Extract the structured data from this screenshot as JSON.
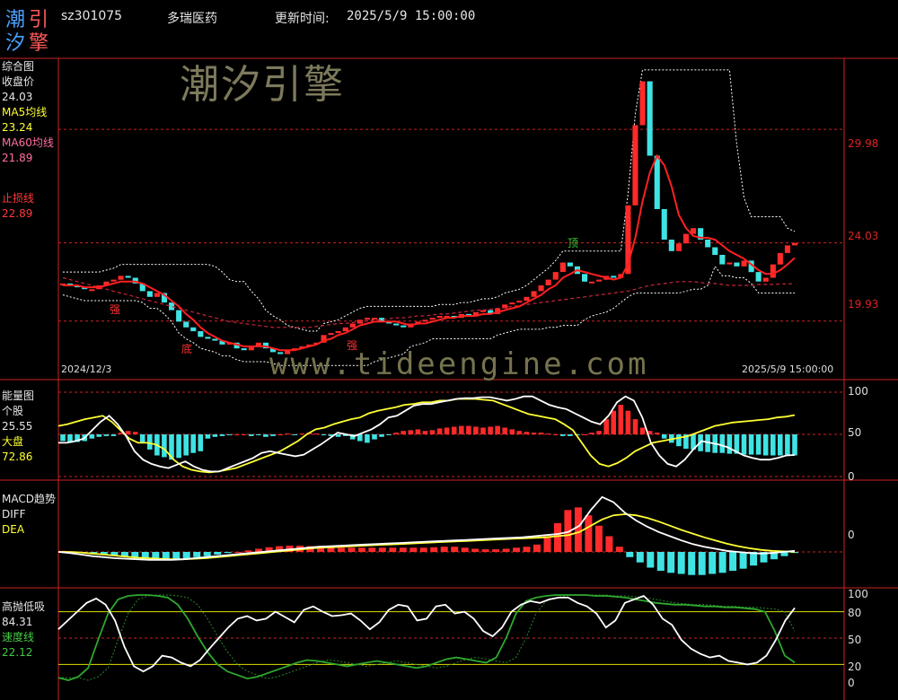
{
  "header": {
    "code": "sz301075",
    "name": "多瑞医药",
    "update_label": "更新时间:",
    "update_time": "2025/5/9 15:00:00",
    "logo_chars": [
      "潮",
      "引",
      "汐",
      "擎"
    ]
  },
  "watermark": {
    "brand": "潮汐引擎",
    "url": "www.tideengine.com"
  },
  "colors": {
    "up": "#ff2a2a",
    "down": "#3fe3e3",
    "ma5": "#ffff33",
    "ma60": "#ff6fa0",
    "ma": "#ff2020",
    "grid": "#cc2222",
    "axisText": "#dd2222"
  },
  "panels": {
    "main": {
      "title": "综合图",
      "close_label": "收盘价",
      "close_value": "24.03",
      "ma5_label": "MA5均线",
      "ma5_value": "23.24",
      "ma60_label": "MA60均线",
      "ma60_value": "21.89",
      "stop_label": "止损线",
      "stop_value": "22.89",
      "ticks": [
        "29.98",
        "24.03",
        "19.93"
      ],
      "date_start": "2024/12/3",
      "date_end": "2025/5/9 15:00:00",
      "annotations": [
        "强",
        "底",
        "强",
        "顶"
      ]
    },
    "energy": {
      "title": "能量图",
      "stock_label": "个股",
      "stock_value": "25.55",
      "market_label": "大盘",
      "market_value": "72.86",
      "ticks": [
        "100",
        "50",
        "0"
      ]
    },
    "macd": {
      "title": "MACD趋势",
      "diff_label": "DIFF",
      "dea_label": "DEA",
      "ticks": [
        "0"
      ]
    },
    "kdj": {
      "title": "高抛低吸",
      "value1": "84.31",
      "speed_label": "速度线",
      "speed_value": "22.12",
      "ticks": [
        "100",
        "80",
        "50",
        "20",
        "0"
      ]
    }
  },
  "chart_data": [
    {
      "type": "candlestick",
      "title": "综合图",
      "x_range": [
        "2024/12/3",
        "2025/5/9"
      ],
      "ylim": [
        17.0,
        33.0
      ],
      "y_ticks": [
        19.93,
        24.03,
        29.98
      ],
      "closes": [
        21.9,
        21.8,
        21.7,
        21.6,
        21.6,
        21.8,
        22.0,
        22.1,
        22.3,
        22.2,
        21.9,
        21.5,
        21.2,
        21.4,
        20.9,
        20.5,
        19.9,
        19.6,
        19.4,
        19.1,
        19.0,
        18.9,
        18.7,
        18.8,
        18.5,
        18.4,
        18.6,
        18.8,
        18.5,
        18.3,
        18.2,
        18.4,
        18.5,
        18.6,
        18.7,
        18.8,
        19.2,
        19.3,
        19.4,
        19.6,
        19.8,
        20.0,
        20.1,
        20.1,
        19.9,
        19.8,
        19.7,
        19.6,
        19.8,
        19.9,
        20.0,
        20.1,
        20.2,
        20.2,
        20.1,
        20.3,
        20.2,
        20.4,
        20.5,
        20.3,
        20.6,
        20.8,
        20.9,
        21.0,
        21.2,
        21.5,
        21.8,
        22.1,
        22.5,
        23.0,
        22.8,
        22.4,
        22.0,
        22.0,
        22.1,
        22.3,
        22.2,
        22.4,
        26.0,
        30.2,
        32.5,
        28.6,
        25.8,
        24.2,
        23.6,
        24.0,
        24.5,
        24.8,
        24.2,
        23.8,
        23.4,
        22.9,
        23.0,
        22.8,
        23.1,
        22.5,
        22.0,
        22.2,
        22.9,
        23.5,
        23.9,
        24.03
      ],
      "series": [
        {
          "name": "MA5均线",
          "values": [
            21.8,
            21.8,
            21.8,
            21.7,
            21.7,
            21.7,
            21.8,
            21.9,
            22.0,
            22.0,
            22.0,
            21.9,
            21.7,
            21.5,
            21.3,
            21.0,
            20.7,
            20.3,
            20.0,
            19.6,
            19.3,
            19.1,
            18.9,
            18.8,
            18.7,
            18.6,
            18.6,
            18.6,
            18.6,
            18.5,
            18.4,
            18.4,
            18.4,
            18.5,
            18.6,
            18.7,
            18.9,
            19.0,
            19.2,
            19.3,
            19.5,
            19.7,
            19.8,
            19.9,
            19.9,
            19.9,
            19.9,
            19.8,
            19.7,
            19.8,
            19.8,
            19.9,
            20.0,
            20.1,
            20.1,
            20.2,
            20.2,
            20.2,
            20.3,
            20.3,
            20.4,
            20.5,
            20.6,
            20.7,
            20.9,
            21.1,
            21.3,
            21.6,
            21.8,
            22.2,
            22.4,
            22.6,
            22.5,
            22.4,
            22.3,
            22.2,
            22.1,
            22.2,
            22.9,
            24.3,
            26.2,
            27.7,
            28.6,
            28.1,
            27.0,
            25.5,
            24.8,
            24.4,
            24.3,
            24.3,
            24.2,
            23.9,
            23.6,
            23.4,
            23.2,
            22.9,
            22.6,
            22.4,
            22.4,
            22.6,
            22.9,
            23.24
          ]
        },
        {
          "name": "MA60均线",
          "values": [
            22.2,
            22.1,
            22.0,
            21.9,
            21.8,
            21.7,
            21.6,
            21.5,
            21.4,
            21.3,
            21.2,
            21.1,
            21.0,
            20.9,
            20.8,
            20.7,
            20.6,
            20.5,
            20.4,
            20.3,
            20.2,
            20.1,
            20.0,
            19.9,
            19.85,
            19.8,
            19.75,
            19.7,
            19.65,
            19.6,
            19.6,
            19.6,
            19.6,
            19.6,
            19.6,
            19.65,
            19.7,
            19.75,
            19.8,
            19.8,
            19.85,
            19.9,
            19.95,
            20.0,
            20.0,
            20.05,
            20.1,
            20.1,
            20.15,
            20.2,
            20.2,
            20.25,
            20.3,
            20.3,
            20.35,
            20.4,
            20.45,
            20.5,
            20.5,
            20.55,
            20.6,
            20.65,
            20.7,
            20.75,
            20.8,
            20.85,
            20.9,
            20.95,
            21.0,
            21.05,
            21.1,
            21.15,
            21.2,
            21.25,
            21.3,
            21.35,
            21.4,
            21.45,
            21.5,
            21.6,
            21.7,
            21.8,
            21.85,
            21.9,
            21.95,
            22.0,
            22.0,
            22.0,
            21.95,
            21.9,
            21.9,
            21.85,
            21.8,
            21.8,
            21.8,
            21.8,
            21.85,
            21.85,
            21.85,
            21.87,
            21.88,
            21.89
          ]
        }
      ]
    },
    {
      "type": "bar",
      "title": "能量图",
      "ylim": [
        0,
        100
      ],
      "y_ticks": [
        0,
        50,
        100
      ],
      "bars": [
        -8,
        -10,
        -9,
        -8,
        -5,
        -3,
        -2,
        -2,
        2,
        4,
        3,
        -10,
        -18,
        -25,
        -27,
        -30,
        -28,
        -25,
        -22,
        -20,
        -5,
        -3,
        -2,
        -1,
        0,
        0,
        -2,
        -1,
        -3,
        -2,
        0,
        1,
        -1,
        1,
        2,
        1,
        -1,
        -2,
        -3,
        -2,
        -6,
        -8,
        -10,
        -6,
        -3,
        -1,
        2,
        4,
        5,
        6,
        4,
        5,
        7,
        8,
        9,
        10,
        10,
        9,
        8,
        9,
        10,
        8,
        6,
        4,
        3,
        2,
        2,
        1,
        0,
        -2,
        -2,
        -1,
        0,
        2,
        4,
        18,
        28,
        35,
        28,
        18,
        8,
        4,
        2,
        -5,
        -10,
        -14,
        -17,
        -18,
        -20,
        -21,
        -22,
        -22,
        -23,
        -23,
        -24,
        -24,
        -24,
        -25,
        -25,
        -25,
        -25,
        -25
      ],
      "series": [
        {
          "name": "个股",
          "values": [
            40,
            40,
            42,
            45,
            55,
            65,
            72,
            62,
            48,
            30,
            20,
            15,
            12,
            10,
            14,
            18,
            12,
            8,
            6,
            6,
            10,
            14,
            18,
            22,
            28,
            30,
            28,
            26,
            24,
            26,
            32,
            38,
            45,
            52,
            50,
            48,
            52,
            56,
            62,
            70,
            72,
            78,
            84,
            86,
            86,
            88,
            90,
            92,
            93,
            93,
            94,
            94,
            92,
            90,
            92,
            95,
            95,
            90,
            85,
            82,
            80,
            75,
            70,
            65,
            62,
            72,
            88,
            95,
            90,
            70,
            40,
            25,
            15,
            12,
            20,
            32,
            42,
            40,
            38,
            35,
            30,
            25,
            22,
            20,
            20,
            22,
            25,
            25.55
          ]
        },
        {
          "name": "大盘",
          "values": [
            60,
            62,
            65,
            68,
            70,
            72,
            65,
            55,
            45,
            40,
            40,
            38,
            32,
            20,
            12,
            8,
            6,
            5,
            6,
            8,
            10,
            14,
            18,
            22,
            26,
            30,
            36,
            42,
            50,
            56,
            58,
            62,
            65,
            68,
            70,
            75,
            78,
            80,
            82,
            85,
            86,
            88,
            88,
            90,
            90,
            92,
            92,
            92,
            91,
            90,
            86,
            82,
            78,
            74,
            72,
            70,
            68,
            62,
            55,
            40,
            25,
            15,
            12,
            16,
            22,
            30,
            35,
            40,
            42,
            44,
            46,
            48,
            52,
            56,
            60,
            62,
            64,
            65,
            66,
            67,
            68,
            70,
            71,
            72.86
          ]
        }
      ]
    },
    {
      "type": "bar",
      "title": "MACD趋势",
      "ylim": [
        -0.6,
        1.2
      ],
      "y_ticks": [
        0
      ],
      "bars": [
        0.02,
        0.01,
        0.0,
        -0.02,
        -0.04,
        -0.06,
        -0.08,
        -0.1,
        -0.12,
        -0.14,
        -0.15,
        -0.14,
        -0.12,
        -0.1,
        -0.08,
        -0.05,
        -0.02,
        0.0,
        0.03,
        0.06,
        0.09,
        0.11,
        0.12,
        0.12,
        0.11,
        0.1,
        0.09,
        0.08,
        0.08,
        0.08,
        0.08,
        0.08,
        0.08,
        0.08,
        0.08,
        0.08,
        0.09,
        0.1,
        0.1,
        0.08,
        0.06,
        0.05,
        0.05,
        0.06,
        0.08,
        0.1,
        0.14,
        0.3,
        0.55,
        0.8,
        0.85,
        0.7,
        0.5,
        0.3,
        0.1,
        -0.1,
        -0.2,
        -0.3,
        -0.36,
        -0.4,
        -0.42,
        -0.44,
        -0.44,
        -0.42,
        -0.4,
        -0.36,
        -0.32,
        -0.26,
        -0.2,
        -0.14,
        -0.08,
        -0.02
      ],
      "series": [
        {
          "name": "DIFF",
          "values": [
            0.0,
            -0.02,
            -0.05,
            -0.08,
            -0.1,
            -0.12,
            -0.13,
            -0.14,
            -0.15,
            -0.15,
            -0.15,
            -0.14,
            -0.12,
            -0.1,
            -0.08,
            -0.06,
            -0.04,
            -0.02,
            0.0,
            0.02,
            0.04,
            0.06,
            0.08,
            0.1,
            0.11,
            0.12,
            0.13,
            0.14,
            0.15,
            0.16,
            0.17,
            0.18,
            0.19,
            0.2,
            0.21,
            0.22,
            0.23,
            0.24,
            0.25,
            0.26,
            0.27,
            0.28,
            0.3,
            0.32,
            0.34,
            0.38,
            0.5,
            0.8,
            1.05,
            0.95,
            0.75,
            0.6,
            0.48,
            0.38,
            0.3,
            0.22,
            0.15,
            0.1,
            0.06,
            0.02,
            0.0,
            -0.02,
            -0.03,
            -0.02,
            0.0,
            0.02
          ]
        },
        {
          "name": "DEA",
          "values": [
            0.0,
            0.0,
            -0.01,
            -0.03,
            -0.05,
            -0.07,
            -0.09,
            -0.11,
            -0.12,
            -0.13,
            -0.14,
            -0.14,
            -0.13,
            -0.12,
            -0.1,
            -0.08,
            -0.06,
            -0.04,
            -0.02,
            0.0,
            0.02,
            0.04,
            0.06,
            0.08,
            0.09,
            0.1,
            0.11,
            0.12,
            0.13,
            0.14,
            0.15,
            0.16,
            0.17,
            0.18,
            0.19,
            0.2,
            0.21,
            0.22,
            0.23,
            0.24,
            0.25,
            0.26,
            0.27,
            0.28,
            0.3,
            0.32,
            0.38,
            0.5,
            0.62,
            0.7,
            0.72,
            0.7,
            0.65,
            0.58,
            0.5,
            0.42,
            0.35,
            0.28,
            0.22,
            0.16,
            0.11,
            0.07,
            0.04,
            0.02,
            0.01,
            0.0
          ]
        }
      ]
    },
    {
      "type": "line",
      "title": "高抛低吸",
      "ylim": [
        0,
        100
      ],
      "y_ticks": [
        0,
        20,
        50,
        80,
        100
      ],
      "reference_lines": [
        80,
        50,
        20
      ],
      "series": [
        {
          "name": "高抛低吸",
          "values": [
            60,
            70,
            80,
            90,
            95,
            88,
            70,
            40,
            18,
            12,
            18,
            30,
            28,
            22,
            18,
            25,
            38,
            50,
            62,
            72,
            75,
            70,
            72,
            80,
            74,
            68,
            82,
            86,
            80,
            75,
            76,
            78,
            70,
            60,
            68,
            82,
            88,
            86,
            70,
            72,
            86,
            88,
            78,
            80,
            72,
            58,
            52,
            62,
            80,
            88,
            92,
            90,
            94,
            96,
            96,
            90,
            86,
            78,
            62,
            70,
            90,
            94,
            98,
            88,
            72,
            65,
            48,
            38,
            32,
            28,
            30,
            24,
            22,
            20,
            22,
            30,
            48,
            70,
            84.31
          ]
        },
        {
          "name": "速度线",
          "values": [
            5,
            2,
            6,
            16,
            48,
            78,
            94,
            98,
            99,
            99,
            98,
            96,
            88,
            72,
            52,
            34,
            20,
            12,
            8,
            4,
            6,
            10,
            14,
            18,
            22,
            25,
            24,
            22,
            20,
            18,
            20,
            22,
            24,
            22,
            20,
            18,
            16,
            18,
            22,
            26,
            28,
            26,
            24,
            22,
            28,
            50,
            78,
            92,
            96,
            98,
            99,
            99,
            99,
            99,
            98,
            98,
            97,
            96,
            94,
            92,
            90,
            89,
            88,
            88,
            87,
            86,
            86,
            85,
            85,
            84,
            83,
            80,
            58,
            30,
            22.12
          ]
        }
      ]
    }
  ]
}
